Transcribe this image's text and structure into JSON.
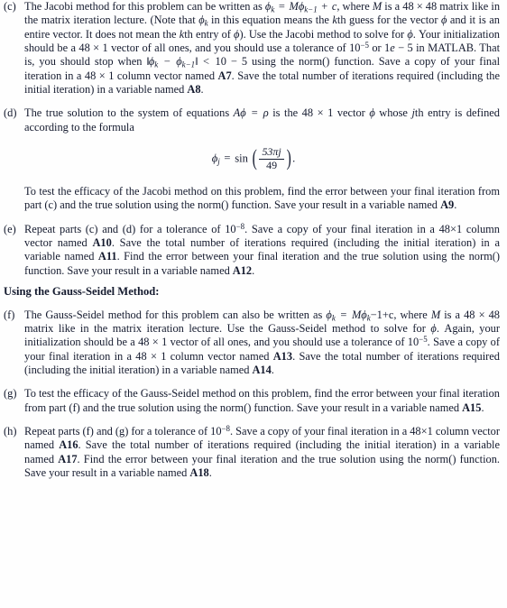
{
  "document": {
    "type": "homework-assignment-page",
    "text_color": "#141a2e",
    "background_color": "#fefefe"
  },
  "items": [
    {
      "id": "c",
      "label": "(c)",
      "segments": {
        "s1": "The Jacobi method for this problem can be written as ",
        "phi_k_1": "ϕ",
        "sub_k_1": "k",
        "eq1": "=",
        "M1": "M",
        "phi_k_2": "ϕ",
        "sub_k_2": "k−1",
        "plus1": "+",
        "c1": "c",
        "s2": ", where ",
        "M2": "M",
        "s3": " is a 48 × 48 matrix like in the matrix iteration lecture. (Note that ",
        "phi_k_3": "ϕ",
        "sub_k_3": "k",
        "s4": " in this equation means the ",
        "kth_k": "k",
        "s5": "th guess for the vector ",
        "phi_1": "ϕ",
        "s6": " and it is an entire vector. It does not mean the ",
        "kth_k2": "k",
        "s7": "th entry of ",
        "phi_2": "ϕ",
        "s8": "). Use the Jacobi method to solve for ",
        "phi_3": "ϕ",
        "s9": ". Your initialization should be a 48 × 1 vector of all ones, and you should use a tolerance of ",
        "ten": "10",
        "exp_neg5": "−5",
        "s10": " or 1",
        "e_it": "e",
        "minus5": "− 5",
        "s11": " in MATLAB. That is, you should stop when ",
        "normbar_l": "‖",
        "phi_k_4": "ϕ",
        "sub_k_4": "k",
        "minus_mid": "−",
        "phi_k_5": "ϕ",
        "sub_k_5": "k−1",
        "normbar_r": "‖",
        "lt": "<",
        "ten5": "10 − 5",
        "s12": " using the norm() function. Save a copy of your final iteration in a 48 × 1 column vector named ",
        "varA7": "A7",
        "s13": ". Save the total number of iterations required (including the initial iteration) in a variable named ",
        "varA8": "A8",
        "s14": "."
      }
    },
    {
      "id": "d",
      "label": "(d)",
      "segments": {
        "s1": "The true solution to the system of equations ",
        "A": "A",
        "phi_1": "ϕ",
        "eq": "=",
        "rho": "ρ",
        "s2": " is the 48 × 1 vector ",
        "phi_2": "ϕ",
        "s3": " whose ",
        "j_it": "j",
        "s4": "th entry is defined according to the formula"
      },
      "equation": {
        "lhs_phi": "ϕ",
        "lhs_sub": "j",
        "eq": "=",
        "fn": "sin",
        "paren_left": "(",
        "numerator": "53πj",
        "denominator": "49",
        "paren_right": ")",
        "period": "."
      },
      "followup": {
        "s1": "To test the efficacy of the Jacobi method on this problem, find the error between your final iteration from part (c) and the true solution using the norm() function. Save your result in a variable named ",
        "varA9": "A9",
        "s2": "."
      }
    },
    {
      "id": "e",
      "label": "(e)",
      "segments": {
        "s1": "Repeat parts (c) and (d) for a tolerance of ",
        "ten": "10",
        "exp": "−8",
        "s2": ". Save a copy of your final iteration in a 48×1 column vector named ",
        "varA10": "A10",
        "s3": ". Save the total number of iterations required (including the initial iteration) in a variable named ",
        "varA11": "A11",
        "s4": ". Find the error between your final iteration and the true solution using the norm() function. Save your result in a variable named ",
        "varA12": "A12",
        "s5": "."
      }
    }
  ],
  "section_heading": "Using the Gauss-Seidel Method:",
  "items2": [
    {
      "id": "f",
      "label": "(f)",
      "segments": {
        "s1": "The Gauss-Seidel method for this problem can also be written as ",
        "phi_k": "ϕ",
        "sub_k": "k",
        "eq": "=",
        "M1": "M",
        "phi_k2": "ϕ",
        "sub_k2": "k",
        "minus1c": "−1+c",
        "s2": ", where ",
        "M2": "M",
        "s3": " is a 48 × 48 matrix like in the matrix iteration lecture. Use the Gauss-Seidel method to solve for ",
        "phi": "ϕ",
        "s4": ". Again, your initialization should be a 48 × 1 vector of all ones, and you should use a tolerance of ",
        "ten": "10",
        "exp": "−5",
        "s5": ". Save a copy of your final iteration in a 48 × 1 column vector named ",
        "varA13": "A13",
        "s6": ". Save the total number of iterations required (including the initial iteration) in a variable named ",
        "varA14": "A14",
        "s7": "."
      }
    },
    {
      "id": "g",
      "label": "(g)",
      "segments": {
        "s1": "To test the efficacy of the Gauss-Seidel method on this problem, find the error between your final iteration from part (f) and the true solution using the norm() function. Save your result in a variable named ",
        "varA15": "A15",
        "s2": "."
      }
    },
    {
      "id": "h",
      "label": "(h)",
      "segments": {
        "s1": "Repeat parts (f) and (g) for a tolerance of ",
        "ten": "10",
        "exp": "−8",
        "s2": ". Save a copy of your final iteration in a 48×1 column vector named ",
        "varA16": "A16",
        "s3": ". Save the total number of iterations required (including the initial iteration) in a variable named ",
        "varA17": "A17",
        "s4": ". Find the error between your final iteration and the true solution using the norm() function. Save your result in a variable named ",
        "varA18": "A18",
        "s5": "."
      }
    }
  ]
}
